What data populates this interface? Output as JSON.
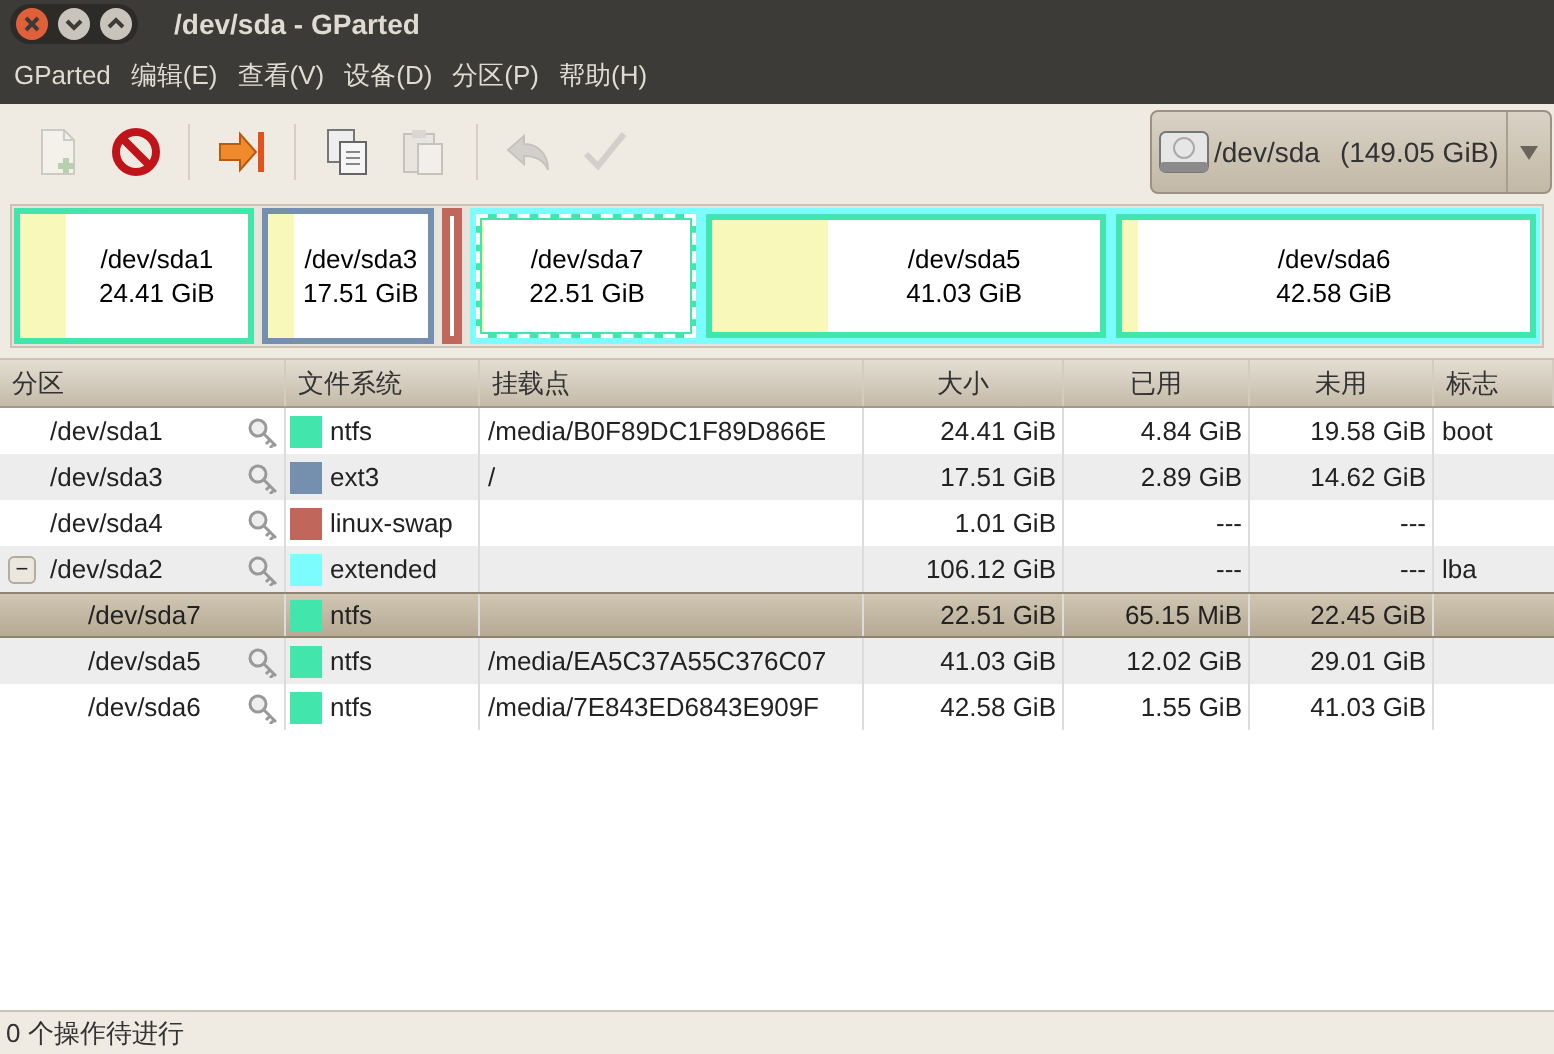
{
  "window": {
    "title": "/dev/sda - GParted"
  },
  "menu": [
    "GParted",
    "编辑(E)",
    "查看(V)",
    "设备(D)",
    "分区(P)",
    "帮助(H)"
  ],
  "toolbar": [
    {
      "kind": "new",
      "disabled": true
    },
    {
      "kind": "delete",
      "disabled": false
    },
    {
      "kind": "resize",
      "disabled": false
    },
    {
      "kind": "copy",
      "disabled": false
    },
    {
      "kind": "paste",
      "disabled": true
    },
    {
      "kind": "undo",
      "disabled": true
    },
    {
      "kind": "apply",
      "disabled": true
    }
  ],
  "device": {
    "name": "/dev/sda",
    "size": "(149.05 GiB)"
  },
  "disk_map": [
    {
      "kind": "partition",
      "name": "/dev/sda1",
      "size": "24.41 GiB",
      "color": "#42e5ac",
      "level": 0.2,
      "selected": false
    },
    {
      "kind": "partition",
      "name": "/dev/sda3",
      "size": "17.51 GiB",
      "color": "#7590ae",
      "level": 0.16,
      "selected": false
    },
    {
      "kind": "bare",
      "color": "#c1665a"
    },
    {
      "kind": "extended",
      "color": "#7dfcfe",
      "selected": false,
      "children": [
        {
          "kind": "partition",
          "name": "/dev/sda7",
          "size": "22.51 GiB",
          "color": "#42e5ac",
          "level": 0.003,
          "selected": true
        },
        {
          "kind": "partition",
          "name": "/dev/sda5",
          "size": "41.03 GiB",
          "color": "#42e5ac",
          "level": 0.3,
          "selected": false
        },
        {
          "kind": "partition",
          "name": "/dev/sda6",
          "size": "42.58 GiB",
          "color": "#42e5ac",
          "level": 0.04,
          "selected": false
        }
      ]
    }
  ],
  "table": {
    "columns": [
      "分区",
      "文件系统",
      "挂载点",
      "大小",
      "已用",
      "未用",
      "标志"
    ],
    "rows": [
      {
        "partition": "/dev/sda1",
        "locked": true,
        "filesystem": "ntfs",
        "color": "#42e5ac",
        "mount": "/media/B0F89DC1F89D866E",
        "size": "24.41 GiB",
        "used": "4.84 GiB",
        "unused": "19.58 GiB",
        "flags": "boot",
        "selected": false
      },
      {
        "partition": "/dev/sda3",
        "locked": true,
        "filesystem": "ext3",
        "color": "#7590ae",
        "mount": "/",
        "size": "17.51 GiB",
        "used": "2.89 GiB",
        "unused": "14.62 GiB",
        "selected": false
      },
      {
        "partition": "/dev/sda4",
        "locked": true,
        "filesystem": "linux-swap",
        "color": "#c1665a",
        "size": "1.01 GiB",
        "used": "---",
        "unused": "---",
        "selected": false
      },
      {
        "partition": "/dev/sda2",
        "locked": true,
        "filesystem": "extended",
        "color": "#7dfcfe",
        "size": "106.12 GiB",
        "used": "---",
        "unused": "---",
        "flags": "lba",
        "selected": false,
        "expanded": true,
        "expander": "−",
        "children": [
          {
            "partition": "/dev/sda7",
            "locked": false,
            "filesystem": "ntfs",
            "color": "#42e5ac",
            "size": "22.51 GiB",
            "used": "65.15 MiB",
            "unused": "22.45 GiB",
            "selected": true
          },
          {
            "partition": "/dev/sda5",
            "locked": true,
            "filesystem": "ntfs",
            "color": "#42e5ac",
            "mount": "/media/EA5C37A55C376C07",
            "size": "41.03 GiB",
            "used": "12.02 GiB",
            "unused": "29.01 GiB",
            "selected": false
          },
          {
            "partition": "/dev/sda6",
            "locked": true,
            "filesystem": "ntfs",
            "color": "#42e5ac",
            "mount": "/media/7E843ED6843E909F",
            "size": "42.58 GiB",
            "used": "1.55 GiB",
            "unused": "41.03 GiB",
            "selected": false
          }
        ]
      }
    ]
  },
  "status_bar": "0 个操作待进行"
}
